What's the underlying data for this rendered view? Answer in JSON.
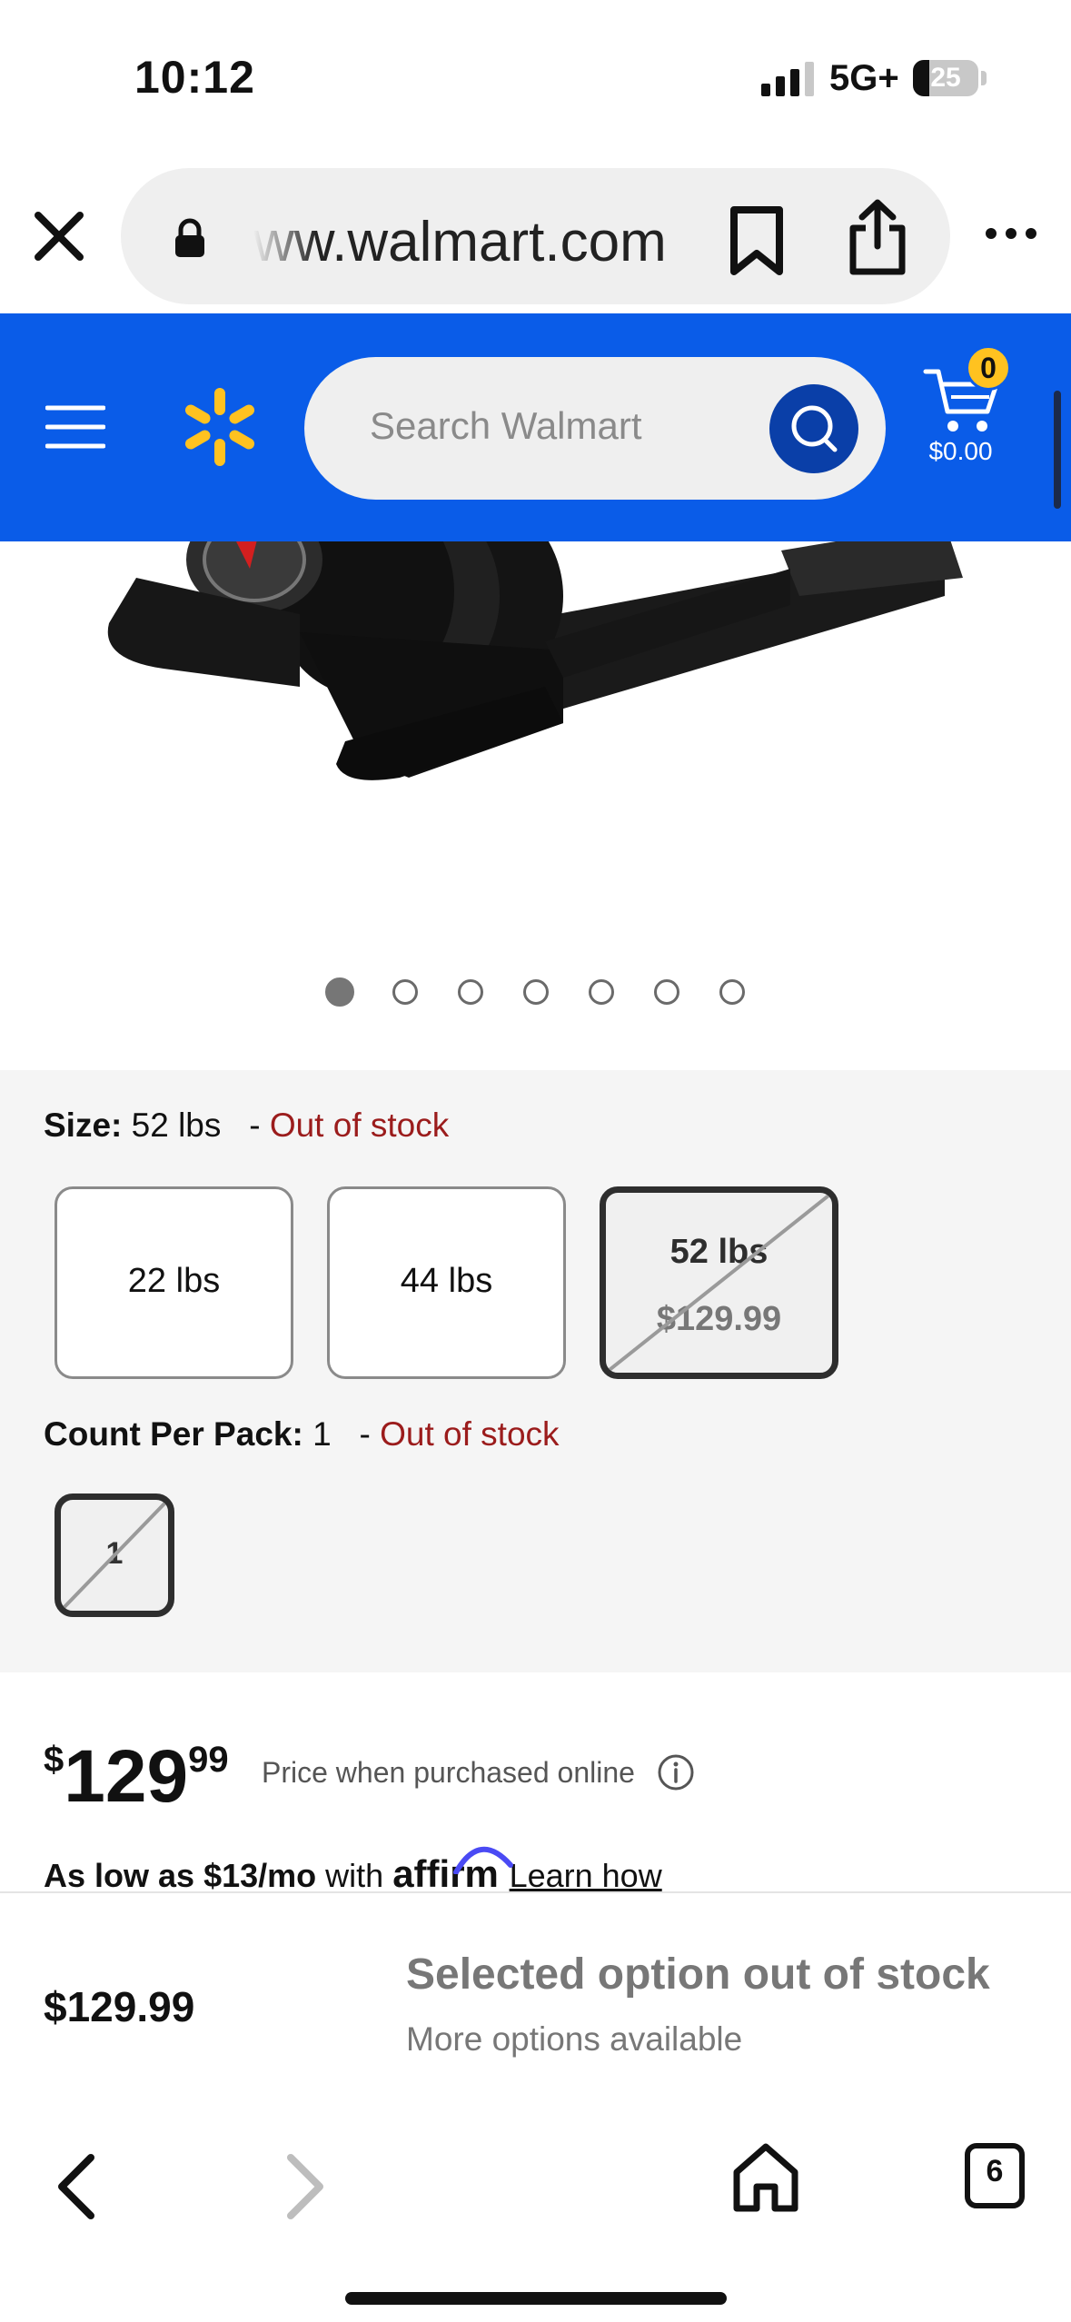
{
  "status_bar": {
    "time": "10:12",
    "network": "5G+",
    "battery": "25"
  },
  "browser": {
    "url": "ww.walmart.com",
    "tabs_count": "6"
  },
  "header": {
    "search_placeholder": "Search Walmart",
    "cart_count": "0",
    "cart_total": "$0.00",
    "brand_color": "#0a5ce8",
    "spark_color": "#ffc220"
  },
  "carousel": {
    "slide_count": 7,
    "active_index": 0
  },
  "variants": {
    "size_label": "Size:",
    "size_value": "52 lbs",
    "size_separator": "-",
    "size_status": "Out of stock",
    "sizes": [
      {
        "label": "22 lbs",
        "price": ""
      },
      {
        "label": "44 lbs",
        "price": ""
      },
      {
        "label": "52 lbs",
        "price": "$129.99"
      }
    ],
    "count_label": "Count Per Pack:",
    "count_value": "1",
    "count_separator": "-",
    "count_status": "Out of stock",
    "count_options": [
      "1"
    ]
  },
  "price": {
    "dollar_sign": "$",
    "integer": "129",
    "cents": "99",
    "note": "Price when purchased online",
    "affirm_prefix": "As low as $13/mo",
    "affirm_with": "with",
    "affirm_brand": "affirm",
    "affirm_link": "Learn how"
  },
  "sticky_bar": {
    "price": "$129.99",
    "message": "Selected option out of stock",
    "sub_message": "More options available"
  }
}
